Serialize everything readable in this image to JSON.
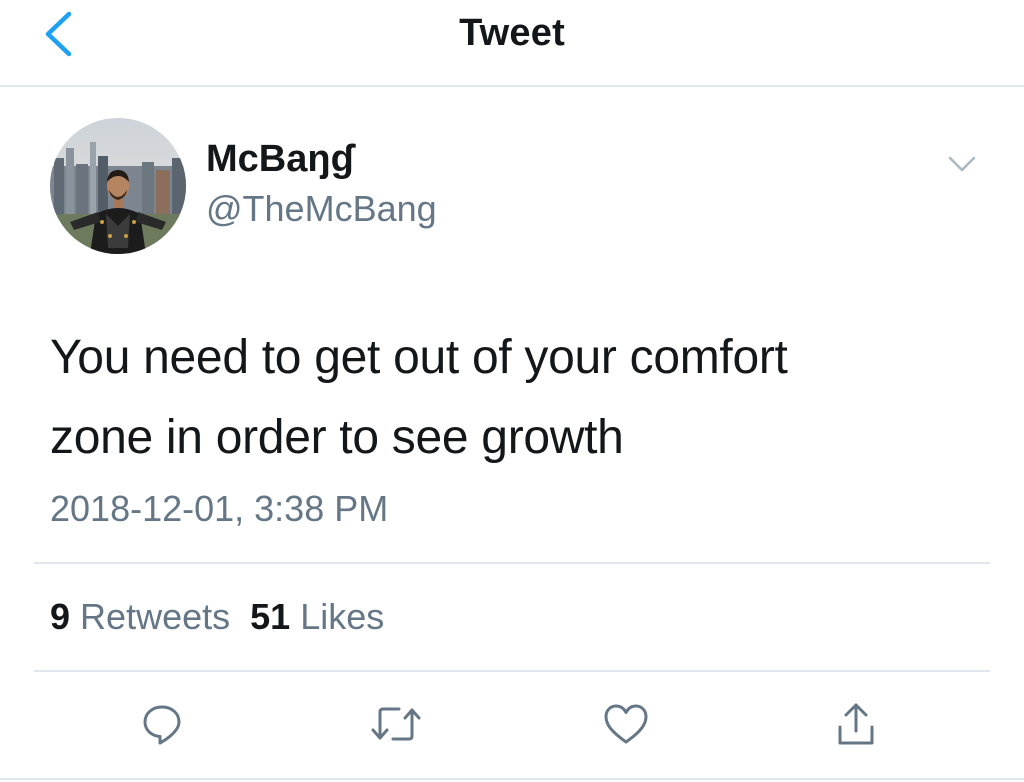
{
  "header": {
    "title": "Tweet",
    "back_icon": "chevron-left-icon"
  },
  "author": {
    "display_name": "McBaŋɠ",
    "handle": "@TheMcBang"
  },
  "tweet": {
    "text_line1": "You need to get out of your comfort",
    "text_line2": "zone in order to see growth",
    "timestamp": "2018-12-01, 3:38 PM"
  },
  "stats": {
    "retweet_count": "9",
    "retweet_label": "Retweets",
    "like_count": "51",
    "like_label": "Likes"
  },
  "actions": [
    "reply-icon",
    "retweet-icon",
    "like-icon",
    "share-icon"
  ],
  "colors": {
    "accent": "#1da1f2",
    "text": "#14171a",
    "secondary": "#657786",
    "divider": "#e1e8ed"
  }
}
